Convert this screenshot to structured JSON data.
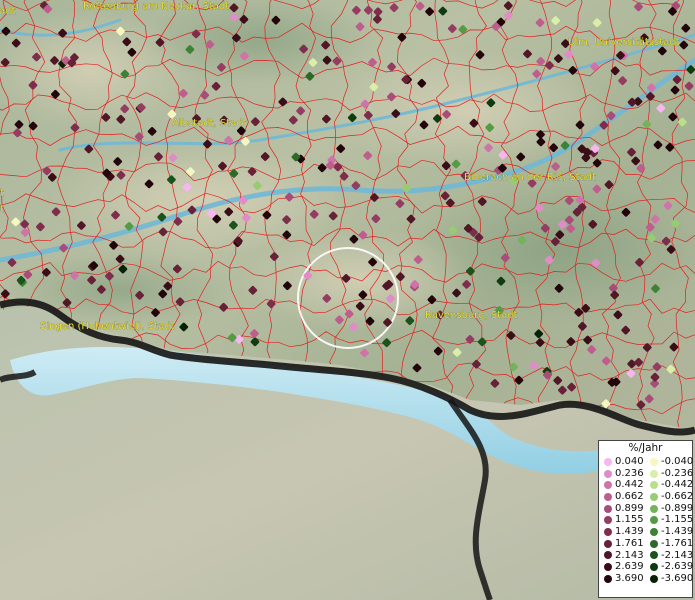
{
  "map": {
    "cities": [
      {
        "id": "rottenburg",
        "label": "Rottenburg am Neckar, Stadt"
      },
      {
        "id": "ulm",
        "label": "Ulm, Universitätsstadt"
      },
      {
        "id": "albstadt",
        "label": "Albstadt, Stadt"
      },
      {
        "id": "biberach",
        "label": "Biberach an der Riß, Stadt"
      },
      {
        "id": "singen",
        "label": "Singen (Hohentwiel), Stadt"
      },
      {
        "id": "ravensburg",
        "label": "Ravensburg, Stadt"
      },
      {
        "id": "left-edge-1",
        "label": "adt"
      },
      {
        "id": "left-edge-2",
        "label": "t"
      },
      {
        "id": "left-edge-3",
        "label": "t"
      }
    ],
    "colors": {
      "border_line": "#e02020",
      "country_border": "#111111",
      "lake": "#8fd0e8",
      "highlight_circle": "#ffffff"
    }
  },
  "legend": {
    "title": "%/Jahr",
    "positive": [
      {
        "value": "0.040",
        "color": "#f7b6ef"
      },
      {
        "value": "0.236",
        "color": "#e08cc8"
      },
      {
        "value": "0.442",
        "color": "#cf74aa"
      },
      {
        "value": "0.662",
        "color": "#bd5e8f"
      },
      {
        "value": "0.899",
        "color": "#a84d78"
      },
      {
        "value": "1.155",
        "color": "#943d62"
      },
      {
        "value": "1.439",
        "color": "#7e2e4c"
      },
      {
        "value": "1.761",
        "color": "#672238"
      },
      {
        "value": "2.143",
        "color": "#511726"
      },
      {
        "value": "2.639",
        "color": "#3a0e18"
      },
      {
        "value": "3.690",
        "color": "#22050b"
      }
    ],
    "negative": [
      {
        "value": "-0.040",
        "color": "#f6f7c0"
      },
      {
        "value": "-0.236",
        "color": "#d9efa8"
      },
      {
        "value": "-0.442",
        "color": "#b8df8c"
      },
      {
        "value": "-0.662",
        "color": "#96cc72"
      },
      {
        "value": "-0.899",
        "color": "#74b35a"
      },
      {
        "value": "-1.155",
        "color": "#559a45"
      },
      {
        "value": "-1.439",
        "color": "#3d8235"
      },
      {
        "value": "-1.761",
        "color": "#2b6a27"
      },
      {
        "value": "-2.143",
        "color": "#1c521b"
      },
      {
        "value": "-2.639",
        "color": "#0f3b10"
      },
      {
        "value": "-3.690",
        "color": "#052205"
      }
    ]
  }
}
